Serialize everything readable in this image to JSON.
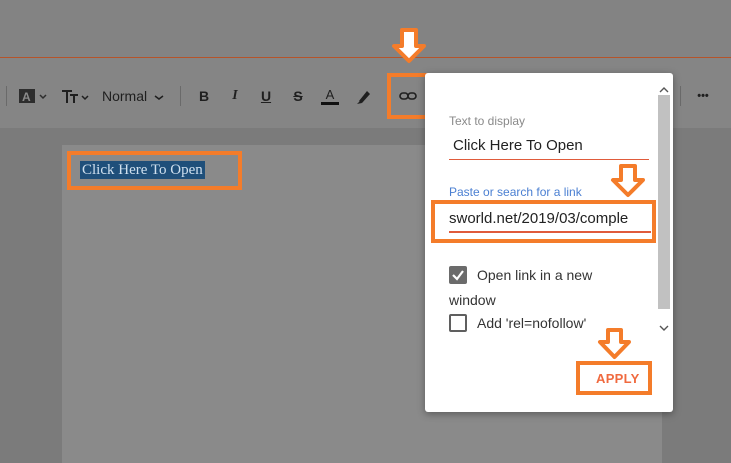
{
  "toolbar": {
    "font_style": "Normal",
    "bold": "B",
    "italic": "I",
    "underline": "U",
    "strike": "S",
    "text_color": "A",
    "more": "•••"
  },
  "editor": {
    "selected_text": "Click Here To Open"
  },
  "link_popup": {
    "text_label": "Text to display",
    "text_value": "Click Here To Open",
    "link_label": "Paste or search for a link",
    "link_value": "sworld.net/2019/03/comple",
    "open_new_window_label": "Open link in a new",
    "open_new_window_label_2": "window",
    "open_new_window_checked": true,
    "nofollow_label": "Add 'rel=nofollow'",
    "nofollow_checked": false,
    "apply_label": "APPLY"
  },
  "colors": {
    "highlight": "#f47c2a",
    "underline_accent": "#e05b3b",
    "link_label_blue": "#4a7fd2",
    "apply": "#f06a3f"
  }
}
